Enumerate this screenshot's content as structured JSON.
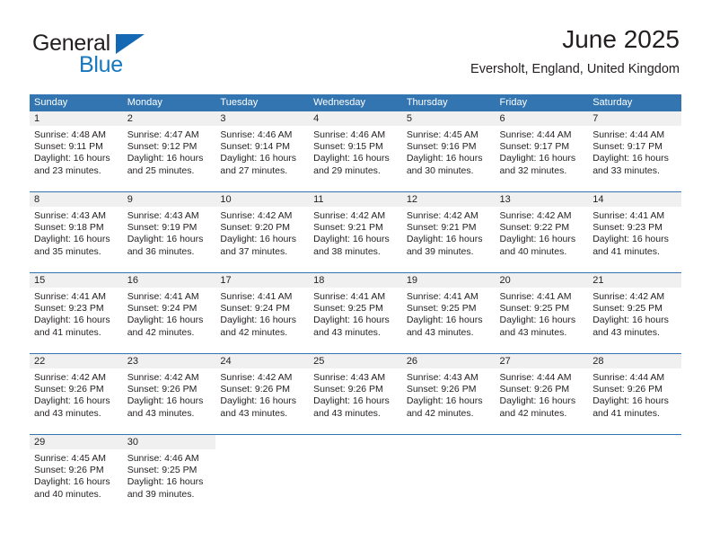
{
  "brand": {
    "word_general": "General",
    "word_blue": "Blue",
    "triangle_color": "#1568b4",
    "blue_text_color": "#1878be"
  },
  "header": {
    "month_title": "June 2025",
    "location": "Eversholt, England, United Kingdom"
  },
  "theme": {
    "header_blue": "#3275b1",
    "daynum_band": "#f0f0f0",
    "row_rule": "#3275b1",
    "text": "#231f20",
    "page_background": "#ffffff"
  },
  "calendar": {
    "weekday_headers": [
      "Sunday",
      "Monday",
      "Tuesday",
      "Wednesday",
      "Thursday",
      "Friday",
      "Saturday"
    ],
    "weeks": [
      {
        "days": [
          {
            "day": "1",
            "sunrise": "Sunrise: 4:48 AM",
            "sunset": "Sunset: 9:11 PM",
            "daylight1": "Daylight: 16 hours",
            "daylight2": "and 23 minutes."
          },
          {
            "day": "2",
            "sunrise": "Sunrise: 4:47 AM",
            "sunset": "Sunset: 9:12 PM",
            "daylight1": "Daylight: 16 hours",
            "daylight2": "and 25 minutes."
          },
          {
            "day": "3",
            "sunrise": "Sunrise: 4:46 AM",
            "sunset": "Sunset: 9:14 PM",
            "daylight1": "Daylight: 16 hours",
            "daylight2": "and 27 minutes."
          },
          {
            "day": "4",
            "sunrise": "Sunrise: 4:46 AM",
            "sunset": "Sunset: 9:15 PM",
            "daylight1": "Daylight: 16 hours",
            "daylight2": "and 29 minutes."
          },
          {
            "day": "5",
            "sunrise": "Sunrise: 4:45 AM",
            "sunset": "Sunset: 9:16 PM",
            "daylight1": "Daylight: 16 hours",
            "daylight2": "and 30 minutes."
          },
          {
            "day": "6",
            "sunrise": "Sunrise: 4:44 AM",
            "sunset": "Sunset: 9:17 PM",
            "daylight1": "Daylight: 16 hours",
            "daylight2": "and 32 minutes."
          },
          {
            "day": "7",
            "sunrise": "Sunrise: 4:44 AM",
            "sunset": "Sunset: 9:17 PM",
            "daylight1": "Daylight: 16 hours",
            "daylight2": "and 33 minutes."
          }
        ]
      },
      {
        "days": [
          {
            "day": "8",
            "sunrise": "Sunrise: 4:43 AM",
            "sunset": "Sunset: 9:18 PM",
            "daylight1": "Daylight: 16 hours",
            "daylight2": "and 35 minutes."
          },
          {
            "day": "9",
            "sunrise": "Sunrise: 4:43 AM",
            "sunset": "Sunset: 9:19 PM",
            "daylight1": "Daylight: 16 hours",
            "daylight2": "and 36 minutes."
          },
          {
            "day": "10",
            "sunrise": "Sunrise: 4:42 AM",
            "sunset": "Sunset: 9:20 PM",
            "daylight1": "Daylight: 16 hours",
            "daylight2": "and 37 minutes."
          },
          {
            "day": "11",
            "sunrise": "Sunrise: 4:42 AM",
            "sunset": "Sunset: 9:21 PM",
            "daylight1": "Daylight: 16 hours",
            "daylight2": "and 38 minutes."
          },
          {
            "day": "12",
            "sunrise": "Sunrise: 4:42 AM",
            "sunset": "Sunset: 9:21 PM",
            "daylight1": "Daylight: 16 hours",
            "daylight2": "and 39 minutes."
          },
          {
            "day": "13",
            "sunrise": "Sunrise: 4:42 AM",
            "sunset": "Sunset: 9:22 PM",
            "daylight1": "Daylight: 16 hours",
            "daylight2": "and 40 minutes."
          },
          {
            "day": "14",
            "sunrise": "Sunrise: 4:41 AM",
            "sunset": "Sunset: 9:23 PM",
            "daylight1": "Daylight: 16 hours",
            "daylight2": "and 41 minutes."
          }
        ]
      },
      {
        "days": [
          {
            "day": "15",
            "sunrise": "Sunrise: 4:41 AM",
            "sunset": "Sunset: 9:23 PM",
            "daylight1": "Daylight: 16 hours",
            "daylight2": "and 41 minutes."
          },
          {
            "day": "16",
            "sunrise": "Sunrise: 4:41 AM",
            "sunset": "Sunset: 9:24 PM",
            "daylight1": "Daylight: 16 hours",
            "daylight2": "and 42 minutes."
          },
          {
            "day": "17",
            "sunrise": "Sunrise: 4:41 AM",
            "sunset": "Sunset: 9:24 PM",
            "daylight1": "Daylight: 16 hours",
            "daylight2": "and 42 minutes."
          },
          {
            "day": "18",
            "sunrise": "Sunrise: 4:41 AM",
            "sunset": "Sunset: 9:25 PM",
            "daylight1": "Daylight: 16 hours",
            "daylight2": "and 43 minutes."
          },
          {
            "day": "19",
            "sunrise": "Sunrise: 4:41 AM",
            "sunset": "Sunset: 9:25 PM",
            "daylight1": "Daylight: 16 hours",
            "daylight2": "and 43 minutes."
          },
          {
            "day": "20",
            "sunrise": "Sunrise: 4:41 AM",
            "sunset": "Sunset: 9:25 PM",
            "daylight1": "Daylight: 16 hours",
            "daylight2": "and 43 minutes."
          },
          {
            "day": "21",
            "sunrise": "Sunrise: 4:42 AM",
            "sunset": "Sunset: 9:25 PM",
            "daylight1": "Daylight: 16 hours",
            "daylight2": "and 43 minutes."
          }
        ]
      },
      {
        "days": [
          {
            "day": "22",
            "sunrise": "Sunrise: 4:42 AM",
            "sunset": "Sunset: 9:26 PM",
            "daylight1": "Daylight: 16 hours",
            "daylight2": "and 43 minutes."
          },
          {
            "day": "23",
            "sunrise": "Sunrise: 4:42 AM",
            "sunset": "Sunset: 9:26 PM",
            "daylight1": "Daylight: 16 hours",
            "daylight2": "and 43 minutes."
          },
          {
            "day": "24",
            "sunrise": "Sunrise: 4:42 AM",
            "sunset": "Sunset: 9:26 PM",
            "daylight1": "Daylight: 16 hours",
            "daylight2": "and 43 minutes."
          },
          {
            "day": "25",
            "sunrise": "Sunrise: 4:43 AM",
            "sunset": "Sunset: 9:26 PM",
            "daylight1": "Daylight: 16 hours",
            "daylight2": "and 43 minutes."
          },
          {
            "day": "26",
            "sunrise": "Sunrise: 4:43 AM",
            "sunset": "Sunset: 9:26 PM",
            "daylight1": "Daylight: 16 hours",
            "daylight2": "and 42 minutes."
          },
          {
            "day": "27",
            "sunrise": "Sunrise: 4:44 AM",
            "sunset": "Sunset: 9:26 PM",
            "daylight1": "Daylight: 16 hours",
            "daylight2": "and 42 minutes."
          },
          {
            "day": "28",
            "sunrise": "Sunrise: 4:44 AM",
            "sunset": "Sunset: 9:26 PM",
            "daylight1": "Daylight: 16 hours",
            "daylight2": "and 41 minutes."
          }
        ]
      },
      {
        "days": [
          {
            "day": "29",
            "sunrise": "Sunrise: 4:45 AM",
            "sunset": "Sunset: 9:26 PM",
            "daylight1": "Daylight: 16 hours",
            "daylight2": "and 40 minutes."
          },
          {
            "day": "30",
            "sunrise": "Sunrise: 4:46 AM",
            "sunset": "Sunset: 9:25 PM",
            "daylight1": "Daylight: 16 hours",
            "daylight2": "and 39 minutes."
          },
          {
            "day": "",
            "sunrise": "",
            "sunset": "",
            "daylight1": "",
            "daylight2": ""
          },
          {
            "day": "",
            "sunrise": "",
            "sunset": "",
            "daylight1": "",
            "daylight2": ""
          },
          {
            "day": "",
            "sunrise": "",
            "sunset": "",
            "daylight1": "",
            "daylight2": ""
          },
          {
            "day": "",
            "sunrise": "",
            "sunset": "",
            "daylight1": "",
            "daylight2": ""
          },
          {
            "day": "",
            "sunrise": "",
            "sunset": "",
            "daylight1": "",
            "daylight2": ""
          }
        ]
      }
    ]
  }
}
